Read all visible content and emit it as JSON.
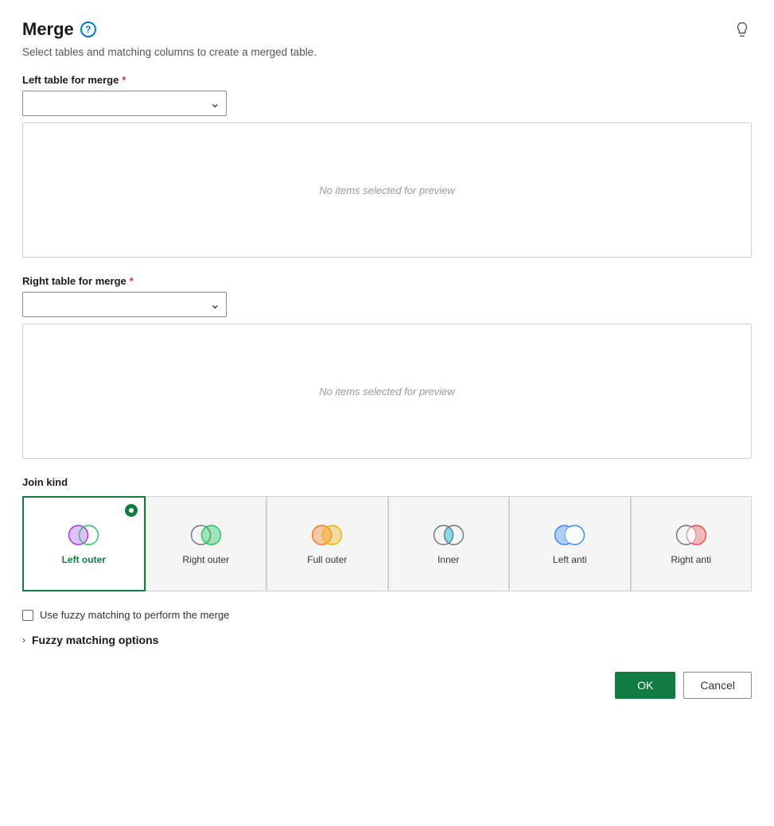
{
  "page": {
    "title": "Merge",
    "subtitle": "Select tables and matching columns to create a merged table.",
    "help_icon": "?",
    "lightbulb": "💡"
  },
  "left_table": {
    "label": "Left table for merge",
    "required": true,
    "placeholder": "",
    "preview_text": "No items selected for preview"
  },
  "right_table": {
    "label": "Right table for merge",
    "required": true,
    "placeholder": "",
    "preview_text": "No items selected for preview"
  },
  "join_kind": {
    "label": "Join kind",
    "options": [
      {
        "id": "left-outer",
        "label": "Left outer",
        "selected": true
      },
      {
        "id": "right-outer",
        "label": "Right outer",
        "selected": false
      },
      {
        "id": "full-outer",
        "label": "Full outer",
        "selected": false
      },
      {
        "id": "inner",
        "label": "Inner",
        "selected": false
      },
      {
        "id": "left-anti",
        "label": "Left anti",
        "selected": false
      },
      {
        "id": "right-anti",
        "label": "Right anti",
        "selected": false
      }
    ]
  },
  "fuzzy": {
    "checkbox_label": "Use fuzzy matching to perform the merge",
    "options_label": "Fuzzy matching options",
    "chevron": "›"
  },
  "buttons": {
    "ok": "OK",
    "cancel": "Cancel"
  }
}
